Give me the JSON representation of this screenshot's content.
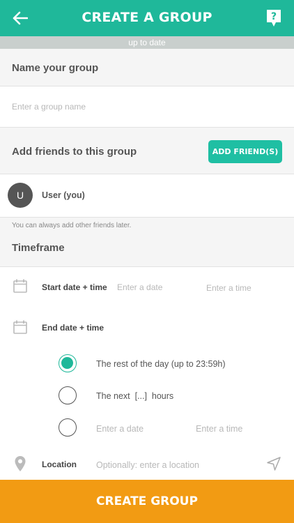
{
  "header": {
    "title": "CREATE A GROUP",
    "back_icon": "arrow-left-icon",
    "help_icon": "question-bubble-icon",
    "color": "#1fb89a"
  },
  "status_strip": {
    "text": "up to date"
  },
  "name_section": {
    "heading": "Name your group",
    "input_placeholder": "Enter a group name"
  },
  "friends_section": {
    "heading": "Add friends to this group",
    "add_button": "ADD FRIEND(S)",
    "members": [
      {
        "initial": "U",
        "name": "User (you)"
      }
    ],
    "note": "You can always add other friends later."
  },
  "timeframe_section": {
    "heading": "Timeframe",
    "start": {
      "label": "Start date + time",
      "date_placeholder": "Enter a date",
      "time_placeholder": "Enter a time"
    },
    "end": {
      "label": "End date + time",
      "options": [
        {
          "text": "The rest of the day (up to 23:59h)",
          "checked": true
        },
        {
          "text": "The next  [...]  hours",
          "checked": false
        },
        {
          "date_placeholder": "Enter a date",
          "time_placeholder": "Enter a time",
          "checked": false
        }
      ]
    },
    "location": {
      "label": "Location",
      "placeholder": "Optionally: enter a location"
    }
  },
  "footer": {
    "button": "CREATE GROUP",
    "color": "#f29b13"
  }
}
